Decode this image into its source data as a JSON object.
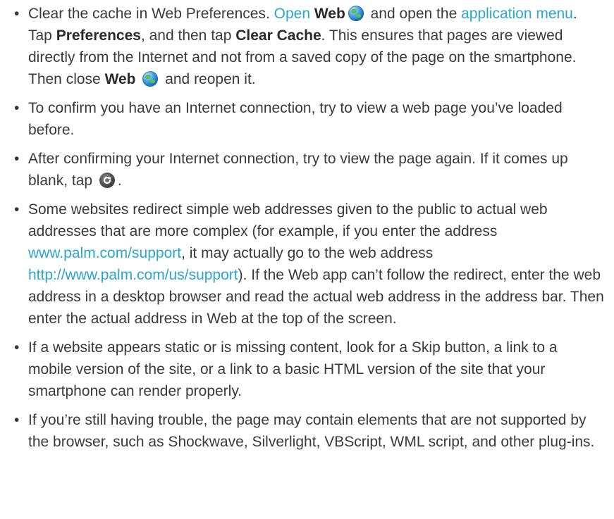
{
  "items": [
    {
      "p1": "Clear the cache in Web Preferences. ",
      "open_link": "Open",
      "web_1": "Web",
      "p2": " and open the ",
      "app_menu_link": "application menu",
      "p3": ". Tap ",
      "preferences": "Preferences",
      "p4": ", and then tap ",
      "clear_cache": "Clear Cache",
      "p5": ". This ensures that pages are viewed directly from the Internet and not from a saved copy of the page on the smartphone. Then close ",
      "web_2": "Web",
      "p6": " and reopen it."
    },
    {
      "text": "To confirm you have an Internet connection, try to view a web page you’ve loaded before."
    },
    {
      "text": "After confirming your Internet connection, try to view the page again. If it comes up blank, tap ",
      "end": "."
    },
    {
      "p1": "Some websites redirect simple web addresses given to the public to actual web addresses that are more complex (for example, if you enter the address ",
      "link1": "www.palm.com/support",
      "p2": ", it may actually go to the web address ",
      "link2": "http://www.palm.com/us/support",
      "p3": "). If the Web app can’t follow the redirect, enter the web address in a desktop browser and read the actual web address in the address bar. Then enter the actual address in Web at the top of the screen."
    },
    {
      "text": "If a website appears static or is missing content, look for a Skip button, a link to a mobile version of the site, or a link to a basic HTML version of the site that your smartphone can render properly."
    },
    {
      "text": "If you’re still having trouble, the page may contain elements that are not supported by the browser, such as Shockwave, Silverlight, VBScript, WML script, and other plug-ins."
    }
  ],
  "bullet_char": "•",
  "colors": {
    "text": "#3a3a3a",
    "link": "#2aa6cf"
  },
  "icons": {
    "web_app": "globe-icon",
    "reload": "reload-icon"
  }
}
